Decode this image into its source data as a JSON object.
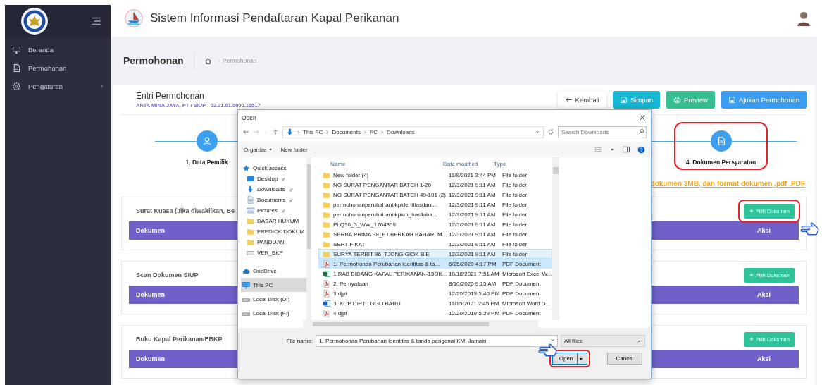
{
  "sidebar": {
    "menu": [
      {
        "label": "Beranda",
        "kind": "monitor",
        "has_submenu": false
      },
      {
        "label": "Permohonan",
        "kind": "document",
        "has_submenu": false
      },
      {
        "label": "Pengaturan",
        "kind": "gear",
        "has_submenu": true
      }
    ]
  },
  "header": {
    "title": "Sistem Informasi Pendaftaran Kapal Perikanan"
  },
  "breadcrumb": {
    "page_title": "Permohonan",
    "trail": "- Permohonan"
  },
  "card": {
    "title": "Entri Permohonan",
    "subtitle": "ARTA MINA JAYA, PT / SIUP : 02.21.01.0000.10517",
    "buttons": [
      {
        "label": "Kembali",
        "kind": "back"
      },
      {
        "label": "Simpan",
        "kind": "save"
      },
      {
        "label": "Preview",
        "kind": "print"
      },
      {
        "label": "Ajukan Permohonan",
        "kind": "submit"
      }
    ],
    "steps": [
      {
        "label": "1. Data Pemilik",
        "kind": "person",
        "highlighted": false
      },
      {
        "label": "4. Dokumen Persyaratan",
        "kind": "document",
        "highlighted": true
      }
    ],
    "note": "dokumen 3MB, dan format dokumen .pdf .PDF",
    "sections": [
      {
        "title": "Surat Kuasa (Jika diwakilkan, Be",
        "button": "Pilih Dokumen",
        "highlighted": true,
        "columns": [
          "Dokumen",
          "Aksi"
        ]
      },
      {
        "title": "Scan Dokumen SIUP",
        "button": "Pilih Dokumen",
        "highlighted": false,
        "columns": [
          "Dokumen",
          "Aksi"
        ]
      },
      {
        "title": "Buku Kapal Perikanan/EBKP",
        "button": "Pilih Dokumen",
        "highlighted": false,
        "columns": [
          "Dokumen",
          "Aksi"
        ]
      }
    ]
  },
  "dialog": {
    "title": "Open",
    "path": [
      "This PC",
      "Documents",
      "PC",
      "Downloads"
    ],
    "search_placeholder": "Search Downloads",
    "toolbar": [
      {
        "label": "Organize",
        "has_menu": true
      },
      {
        "label": "New folder",
        "has_menu": false
      }
    ],
    "nav": [
      {
        "label": "Quick access",
        "kind": "star",
        "pinned": false,
        "selected": false
      },
      {
        "label": "Desktop",
        "kind": "desktop",
        "pinned": true,
        "selected": false
      },
      {
        "label": "Downloads",
        "kind": "downloads",
        "pinned": true,
        "selected": false
      },
      {
        "label": "Documents",
        "kind": "documents",
        "pinned": true,
        "selected": false
      },
      {
        "label": "Pictures",
        "kind": "pictures",
        "pinned": true,
        "selected": false
      },
      {
        "label": "DASAR HUKUM",
        "kind": "folder",
        "pinned": false,
        "selected": false
      },
      {
        "label": "FREDICK DOKUM",
        "kind": "folder",
        "pinned": false,
        "selected": false
      },
      {
        "label": "PANDUAN",
        "kind": "folder",
        "pinned": false,
        "selected": false
      },
      {
        "label": "VER_BKP",
        "kind": "drive",
        "pinned": false,
        "selected": false
      },
      {
        "label": "OneDrive",
        "kind": "cloud",
        "pinned": false,
        "selected": false
      },
      {
        "label": "This PC",
        "kind": "pc",
        "pinned": false,
        "selected": true
      },
      {
        "label": "Local Disk (D:)",
        "kind": "disk",
        "pinned": false,
        "selected": false
      },
      {
        "label": "Local Disk (F:)",
        "kind": "disk",
        "pinned": false,
        "selected": false
      }
    ],
    "columns": [
      "Name",
      "Date modified",
      "Type"
    ],
    "files": [
      {
        "name": "New folder (4)",
        "date": "11/9/2021 3:44 PM",
        "type": "File folder",
        "kind": "folder",
        "selected": false,
        "hovered": false
      },
      {
        "name": "NO SURAT PENGANTAR BATCH 1-20",
        "date": "12/3/2021 9:11 AM",
        "type": "File folder",
        "kind": "folder",
        "selected": false,
        "hovered": false
      },
      {
        "name": "NO SURAT PENGANTAR BATCH 49-101 (2)",
        "date": "12/3/2021 9:11 AM",
        "type": "File folder",
        "kind": "folder",
        "selected": false,
        "hovered": false
      },
      {
        "name": "permohonanperubahanbkpidentitasdant...",
        "date": "12/3/2021 9:11 AM",
        "type": "File folder",
        "kind": "folder",
        "selected": false,
        "hovered": false
      },
      {
        "name": "permohonanperubahanbkpkm_hasilaba...",
        "date": "12/3/2021 9:11 AM",
        "type": "File folder",
        "kind": "folder",
        "selected": false,
        "hovered": false
      },
      {
        "name": "PLQ30_3_WW_1764309",
        "date": "12/3/2021 9:11 AM",
        "type": "File folder",
        "kind": "folder",
        "selected": false,
        "hovered": false
      },
      {
        "name": "SERBA PRIMA 38_PT.BERKAH BAHARI M...",
        "date": "12/3/2021 9:11 AM",
        "type": "File folder",
        "kind": "folder",
        "selected": false,
        "hovered": false
      },
      {
        "name": "SERTIFIKAT",
        "date": "12/3/2021 9:11 AM",
        "type": "File folder",
        "kind": "folder",
        "selected": false,
        "hovered": false
      },
      {
        "name": "SURYA TERBIT 96_TJONG GIOK BIE",
        "date": "12/3/2021 9:11 AM",
        "type": "File folder",
        "kind": "folder",
        "selected": false,
        "hovered": true
      },
      {
        "name": "1. Permohonan Perubahan identitas & ta...",
        "date": "6/25/2020 4:17 PM",
        "type": "PDF Document",
        "kind": "pdf",
        "selected": true,
        "hovered": false
      },
      {
        "name": "1.RAB BIDANG KAPAL PERIKANAN-13OK...",
        "date": "10/18/2021 7:51 AM",
        "type": "Microsoft Excel W...",
        "kind": "excel",
        "selected": false,
        "hovered": false
      },
      {
        "name": "2. Pernyataan",
        "date": "8/10/2020 9:15 AM",
        "type": "PDF Document",
        "kind": "pdf",
        "selected": false,
        "hovered": false
      },
      {
        "name": "3 djpt",
        "date": "12/20/2019 5:40 PM",
        "type": "PDF Document",
        "kind": "pdf",
        "selected": false,
        "hovered": false
      },
      {
        "name": "3. KOP DIPT LOGO BARU",
        "date": "11/15/2021 2:45 PM",
        "type": "Microsoft Word D...",
        "kind": "word",
        "selected": false,
        "hovered": false
      },
      {
        "name": "4 djpt",
        "date": "12/20/2019 5:39 PM",
        "type": "PDF Document",
        "kind": "pdf",
        "selected": false,
        "hovered": false
      }
    ],
    "file_name_label": "File name:",
    "file_name": "1. Permohonan Perubahan identitas & tanda pengenal KM. Jamain",
    "filter": "All files",
    "open_label": "Open",
    "cancel_label": "Cancel",
    "open_highlighted": true
  }
}
